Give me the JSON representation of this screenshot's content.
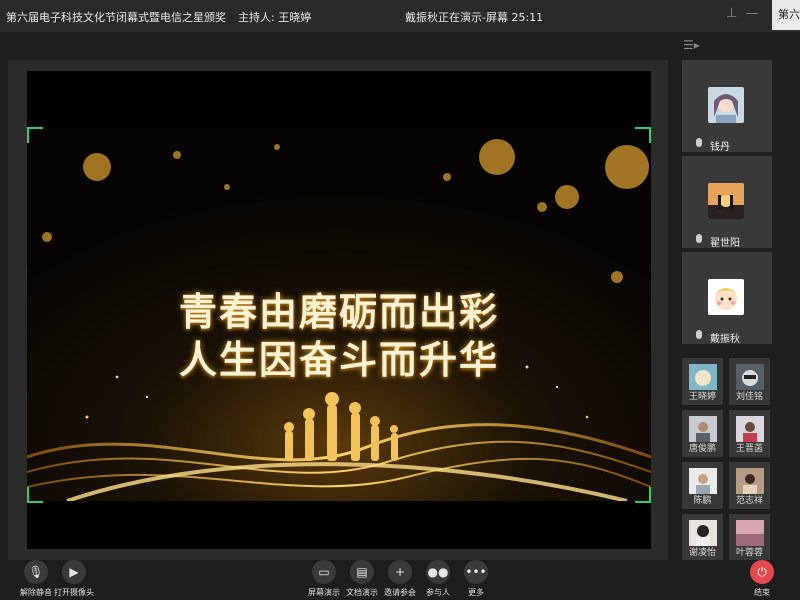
{
  "window": {
    "title": "第六届电子科技文化节闭幕式暨电信之星颁奖",
    "host": "主持人: 王晓婷",
    "presenting_status": "戴振秋正在演示-屏幕 25:11",
    "tab_label": "第六"
  },
  "slide": {
    "line1": "青春由磨砺而出彩",
    "line2": "人生因奋斗而升华"
  },
  "participants_large": [
    {
      "name": "钱丹",
      "avatar": "anime-avatar"
    },
    {
      "name": "翟世阳",
      "avatar": "sunset-silhouette-avatar"
    },
    {
      "name": "戴振秋",
      "avatar": "cartoon-avatar"
    }
  ],
  "participants_small": [
    {
      "name": "王晓婷"
    },
    {
      "name": "刘佳铭"
    },
    {
      "name": "唐俊鹏"
    },
    {
      "name": "王晋菡"
    },
    {
      "name": "陈鹏"
    },
    {
      "name": "范志祥"
    },
    {
      "name": "谢凌怡"
    },
    {
      "name": "叶蓉蓉"
    }
  ],
  "toolbar": {
    "unmute": "解除静音",
    "start_video": "打开摄像头",
    "share_screen": "屏幕演示",
    "share_doc": "文档演示",
    "invite": "邀请参会",
    "participants": "参与人",
    "more": "更多",
    "end": "结束"
  },
  "colors": {
    "accent_end": "#e5484d",
    "frame_corner": "#2fd06a",
    "headline": "#fff3d6"
  }
}
